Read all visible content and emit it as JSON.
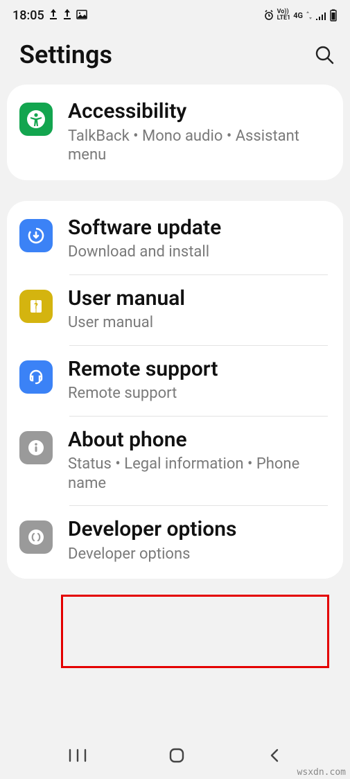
{
  "status_bar": {
    "time": "18:05",
    "volte": "Vo))",
    "lte": "LTE1",
    "signal": "4G"
  },
  "header": {
    "title": "Settings"
  },
  "groups": [
    {
      "items": [
        {
          "id": "accessibility",
          "title": "Accessibility",
          "subtitle": "TalkBack  •  Mono audio  •  Assistant menu",
          "icon_color": "#13a54f"
        }
      ]
    },
    {
      "items": [
        {
          "id": "software-update",
          "title": "Software update",
          "subtitle": "Download and install",
          "icon_color": "#3b82f6"
        },
        {
          "id": "user-manual",
          "title": "User manual",
          "subtitle": "User manual",
          "icon_color": "#d4b40f"
        },
        {
          "id": "remote-support",
          "title": "Remote support",
          "subtitle": "Remote support",
          "icon_color": "#3b82f6"
        },
        {
          "id": "about-phone",
          "title": "About phone",
          "subtitle": "Status  •  Legal information  •  Phone name",
          "icon_color": "#9a9a9a"
        },
        {
          "id": "developer-options",
          "title": "Developer options",
          "subtitle": "Developer options",
          "icon_color": "#9a9a9a"
        }
      ]
    }
  ],
  "watermark": "wsxdn.com"
}
